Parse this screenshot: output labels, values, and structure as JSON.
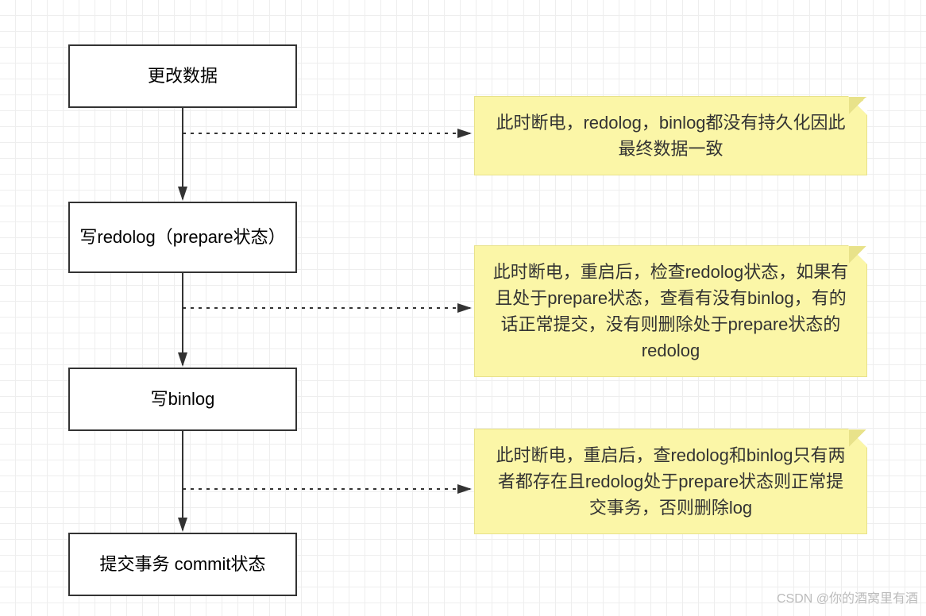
{
  "boxes": {
    "b1": "更改数据",
    "b2": "写redolog（prepare状态）",
    "b3": "写binlog",
    "b4": "提交事务 commit状态"
  },
  "notes": {
    "n1": "此时断电，redolog，binlog都没有持久化因此最终数据一致",
    "n2": "此时断电，重启后，检查redolog状态，如果有且处于prepare状态，查看有没有binlog，有的话正常提交，没有则删除处于prepare状态的redolog",
    "n3": "此时断电，重启后，查redolog和binlog只有两者都存在且redolog处于prepare状态则正常提交事务，否则删除log"
  },
  "watermark": "CSDN @你的酒窝里有酒"
}
